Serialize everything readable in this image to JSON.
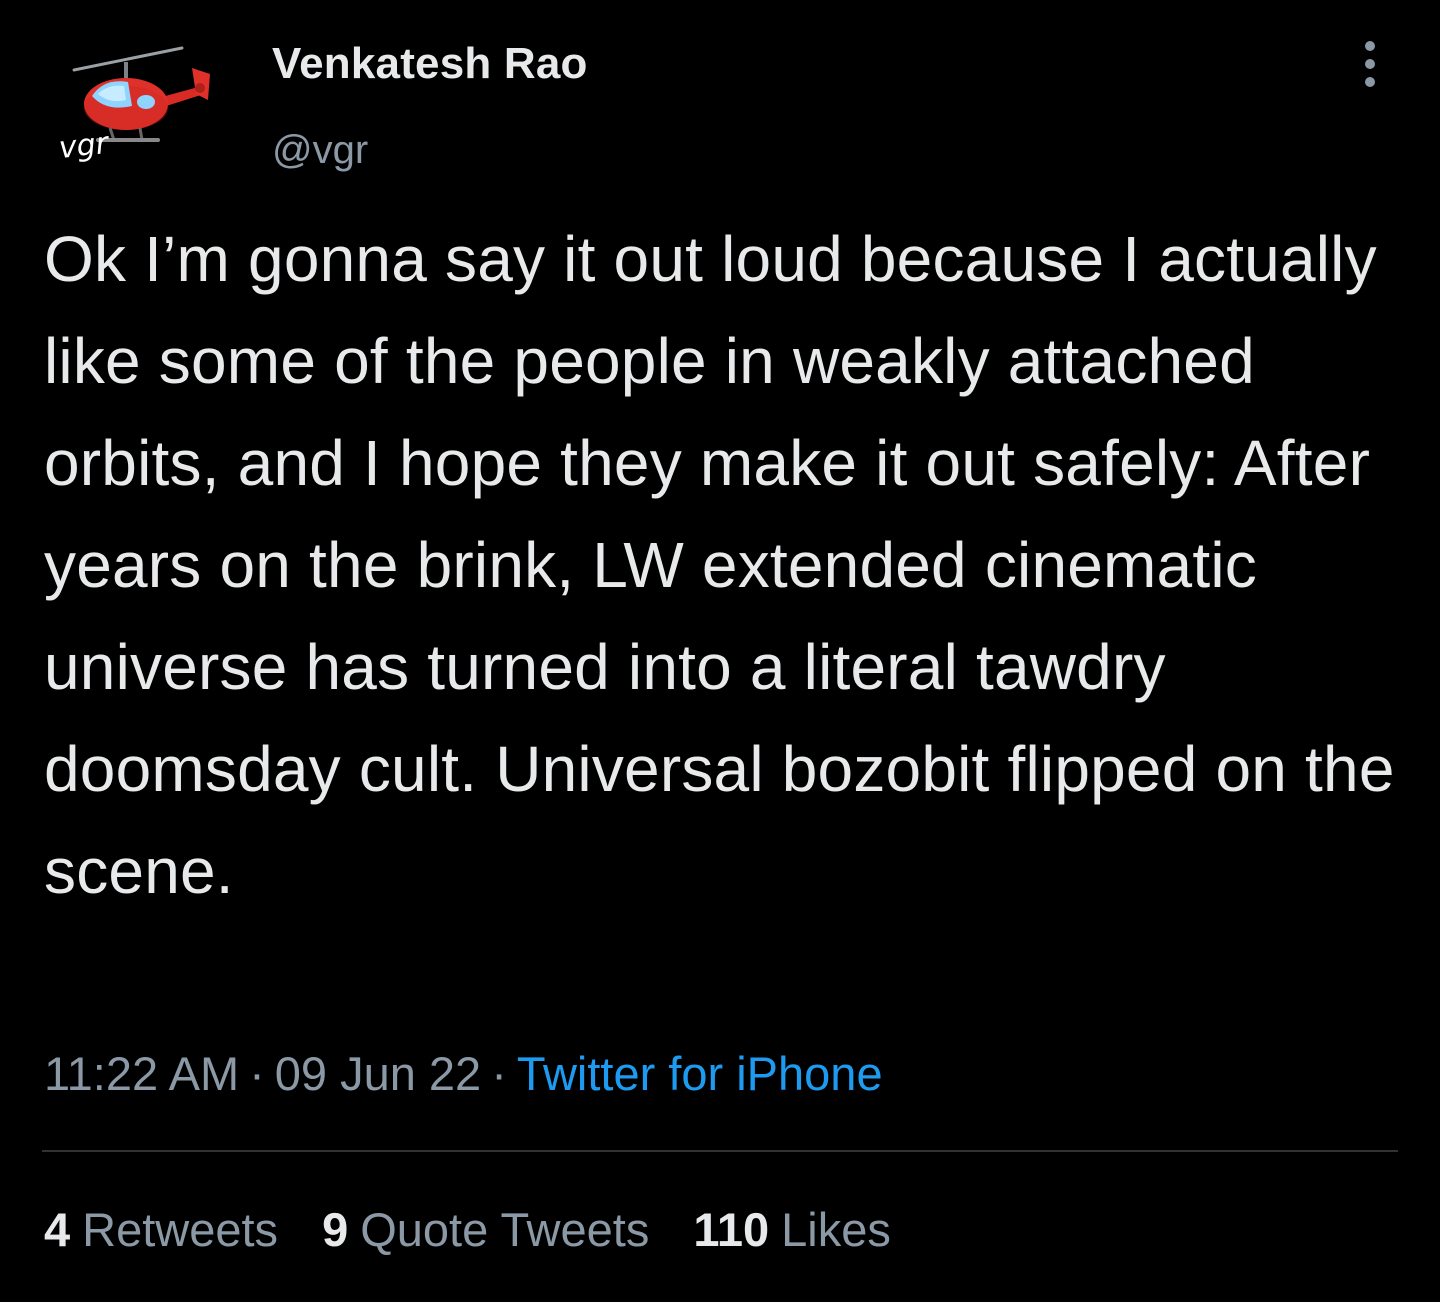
{
  "author": {
    "display_name": "Venkatesh Rao",
    "handle": "@vgr",
    "avatar_text": "vgr"
  },
  "tweet": {
    "text": "Ok I’m gonna say it out loud because I actually like some of the people in weakly attached orbits, and I hope they make it out safely: After years on the brink, LW extended cinematic universe has turned into a literal tawdry doomsday cult. Universal bozobit flipped on the scene.",
    "time": "11:22 AM",
    "date": "09 Jun 22",
    "separator": "·",
    "source": "Twitter for iPhone"
  },
  "stats": {
    "retweets_count": "4",
    "retweets_label": "Retweets",
    "quotes_count": "9",
    "quotes_label": "Quote Tweets",
    "likes_count": "110",
    "likes_label": "Likes"
  },
  "icons": {
    "avatar": "helicopter-icon",
    "more": "more-vertical-icon"
  },
  "colors": {
    "background": "#000000",
    "text": "#e7e9ea",
    "secondary": "#8b98a5",
    "link": "#1d9bf0",
    "divider": "#2f3336",
    "helicopter": "#e0302a"
  }
}
